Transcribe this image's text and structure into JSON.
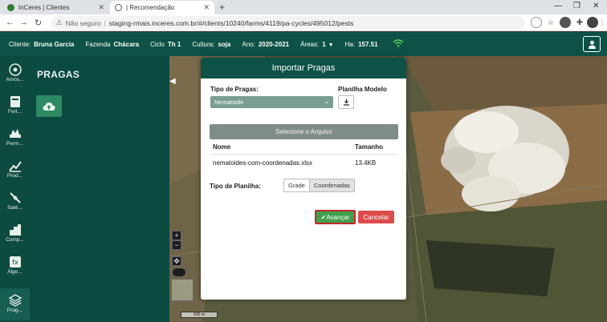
{
  "browser": {
    "tabs": [
      {
        "label": "InCeres | Clientes",
        "active": false
      },
      {
        "label": "| Recomendação",
        "active": true
      }
    ],
    "new_tab": "+",
    "security_label": "Não seguro",
    "url": "staging-rmais.inceres.com.br/#/clients/10240/farms/4119/pa-cycles/495012/pests"
  },
  "header": {
    "cliente_label": "Cliente:",
    "cliente_value": "Bruna Garcia",
    "fazenda_label": "Fazenda",
    "fazenda_value": "Chácara",
    "ciclo_label": "Ciclo",
    "ciclo_value": "Th 1",
    "cultura_label": "Cultura:",
    "cultura_value": "soja",
    "ano_label": "Ano:",
    "ano_value": "2020-2021",
    "areas_label": "Áreas:",
    "areas_value": "1",
    "ha_label": "Ha:",
    "ha_value": "157.51"
  },
  "rail": [
    {
      "label": "Amos...",
      "icon": "sampling-icon"
    },
    {
      "label": "Fert...",
      "icon": "fertility-icon"
    },
    {
      "label": "Perm...",
      "icon": "permissions-icon"
    },
    {
      "label": "Prod...",
      "icon": "productivity-chart-icon"
    },
    {
      "label": "Saté...",
      "icon": "satellite-icon"
    },
    {
      "label": "Comp...",
      "icon": "compare-icon"
    },
    {
      "label": "Álge...",
      "icon": "algebra-icon"
    },
    {
      "label": "Prag...",
      "icon": "pests-layers-icon"
    }
  ],
  "panel": {
    "title": "PRAGAS"
  },
  "map": {
    "scale_label": "500 m",
    "zoom_in": "+",
    "zoom_out": "−"
  },
  "modal": {
    "title": "Importar Pragas",
    "tipo_pragas_label": "Tipo de Pragas:",
    "tipo_pragas_value": "Nematoide",
    "planilha_modelo_label": "Planilha Modelo",
    "select_file_label": "Selecione o Arquivo",
    "table": {
      "columns": [
        "Nome",
        "Tamanho"
      ],
      "rows": [
        {
          "name": "nematoides-com-coordenadas.xlsx",
          "size": "13.4KB"
        }
      ]
    },
    "tipo_planilha_label": "Tipo de Planilha:",
    "tipo_planilha_options": [
      "Grade",
      "Coordenadas"
    ],
    "tipo_planilha_selected": "Coordenadas",
    "advance_label": "Avançar",
    "cancel_label": "Cancelar"
  },
  "colors": {
    "brand": "#0e5247",
    "accept": "#3fa04d",
    "cancel": "#dd4b4b",
    "highlight": "#c62828"
  }
}
